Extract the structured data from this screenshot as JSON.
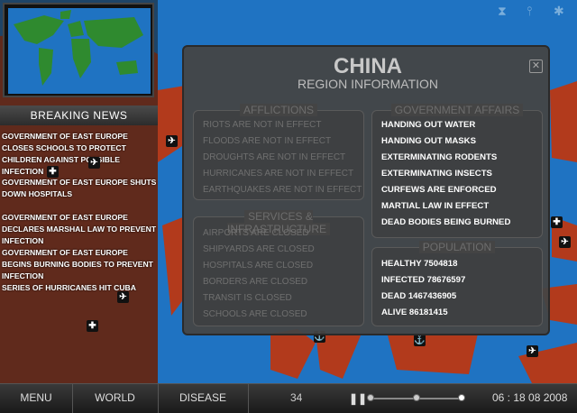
{
  "sidebar": {
    "breaking_news_title": "BREAKING NEWS",
    "news": [
      "GOVERNMENT OF EAST EUROPE CLOSES SCHOOLS TO PROTECT CHILDREN AGAINST POSSIBLE INFECTION",
      "GOVERNMENT OF EAST EUROPE SHUTS DOWN HOSPITALS",
      "GOVERNMENT OF EAST EUROPE DECLARES MARSHAL LAW TO PREVENT INFECTION",
      "GOVERNMENT OF EAST EUROPE BEGINS BURNING BODIES TO PREVENT INFECTION",
      "SERIES OF HURRICANES HIT CUBA"
    ]
  },
  "region": {
    "name": "CHINA",
    "subtitle": "REGION INFORMATION",
    "afflictions": {
      "title": "AFFLICTIONS",
      "items": [
        "RIOTS ARE NOT IN EFFECT",
        "FLOODS ARE NOT IN EFFECT",
        "DROUGHTS ARE NOT IN EFFECT",
        "HURRICANES ARE NOT IN EFFECT",
        "EARTHQUAKES ARE NOT IN EFFECT"
      ]
    },
    "services": {
      "title": "SERVICES & INFRASTRUCTURE",
      "items": [
        "AIRPORTS ARE CLOSED",
        "SHIPYARDS ARE CLOSED",
        "HOSPITALS ARE CLOSED",
        "BORDERS ARE CLOSED",
        "TRANSIT IS CLOSED",
        "SCHOOLS ARE CLOSED"
      ]
    },
    "government": {
      "title": "GOVERNMENT AFFAIRS",
      "items": [
        "HANDING OUT WATER",
        "HANDING OUT MASKS",
        "EXTERMINATING RODENTS",
        "EXTERMINATING INSECTS",
        "CURFEWS ARE ENFORCED",
        "MARTIAL LAW IN EFFECT",
        "DEAD BODIES BEING BURNED"
      ]
    },
    "population": {
      "title": "POPULATION",
      "items": [
        "HEALTHY 7504818",
        "INFECTED 78676597",
        "DEAD 1467436905",
        "ALIVE 86181415"
      ]
    }
  },
  "bottom_bar": {
    "menu": "MENU",
    "world": "WORLD",
    "disease": "DISEASE",
    "counter": "34",
    "datetime": "06 : 18 08 2008"
  },
  "icons": {
    "close": "close-icon",
    "pause": "pause-icon",
    "airport": "airplane-icon",
    "hospital": "hospital-cross-icon",
    "harbor": "anchor-icon"
  },
  "colors": {
    "ocean": "#1f73c2",
    "land_infected": "#b23a1c",
    "land_healthy": "#2f8a2f",
    "modal_bg": "#444444"
  }
}
